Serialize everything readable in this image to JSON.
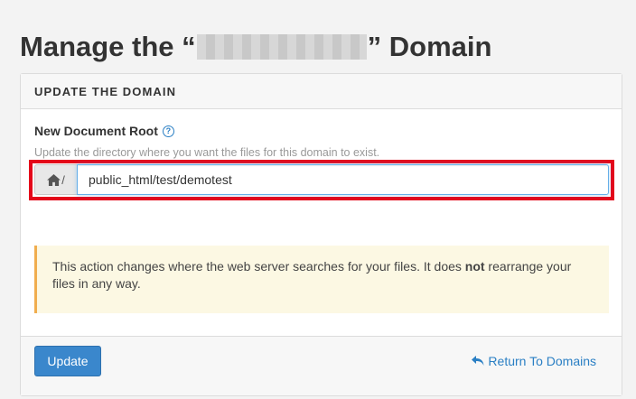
{
  "page": {
    "title_prefix": "Manage the “",
    "title_suffix": "” Domain"
  },
  "panel": {
    "heading": "UPDATE THE DOMAIN",
    "field_label": "New Document Root",
    "help_text": "Update the directory where you want the files for this domain to exist.",
    "path_prefix": "/",
    "document_root_value": "public_html/test/demotest",
    "notice_part1": "This action changes where the web server searches for your files. It does ",
    "notice_bold": "not",
    "notice_part2": " rearrange your files in any way."
  },
  "footer": {
    "update_label": "Update",
    "return_label": "Return To Domains"
  },
  "icons": {
    "help": "question-circle-icon",
    "home": "home-icon",
    "return": "reply-arrow-icon"
  },
  "colors": {
    "accent": "#2a7fc4",
    "button": "#3a87cc",
    "highlight_border": "#e4061a",
    "notice_bg": "#fcf8e3",
    "notice_border": "#f0ad4e"
  }
}
